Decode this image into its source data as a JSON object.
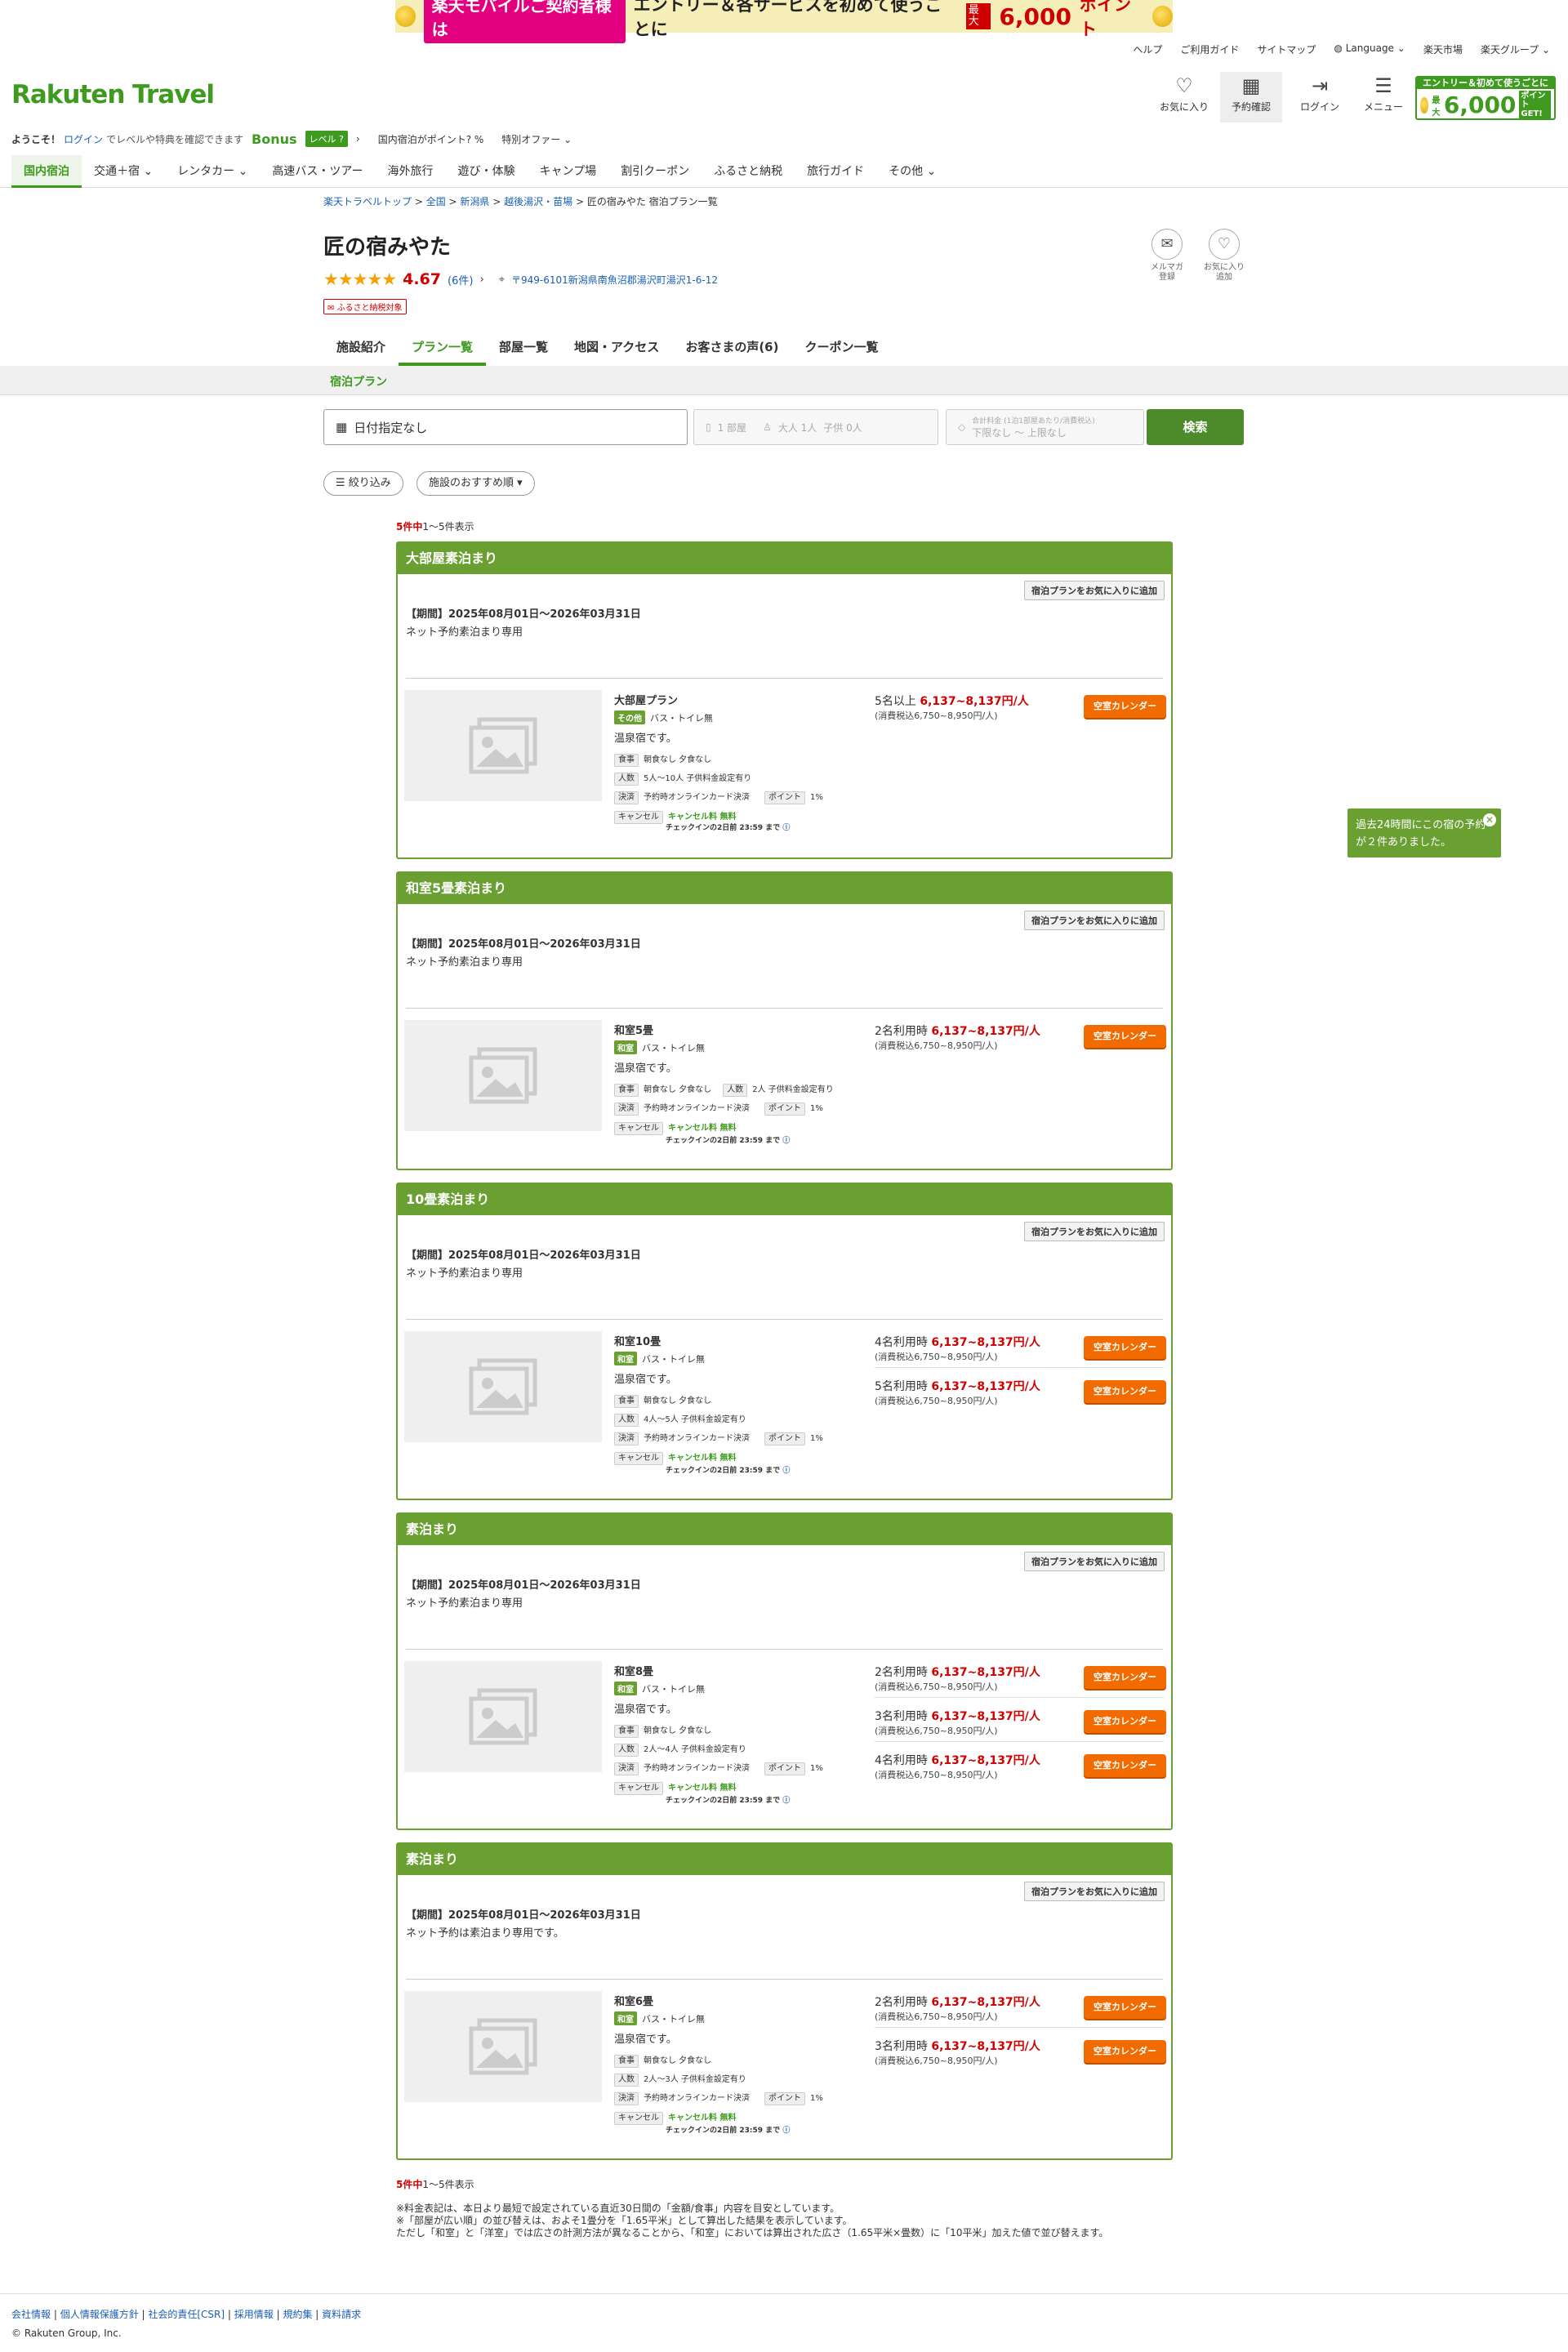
{
  "banner": {
    "pink": "楽天モバイルご契約者様は",
    "main": "エントリー＆各サービスを初めて使うごとに",
    "max": "最大",
    "points": "6,000",
    "pt_suffix": "ポイント"
  },
  "toplinks": [
    "ヘルプ",
    "ご利用ガイド",
    "サイトマップ",
    "Language",
    "楽天市場",
    "楽天グループ"
  ],
  "logo": "Rakuten Travel",
  "header_buttons": [
    {
      "label": "お気に入り",
      "icon": "♡"
    },
    {
      "label": "予約確認",
      "icon": "▦"
    },
    {
      "label": "ログイン",
      "icon": "⇥"
    },
    {
      "label": "メニュー",
      "icon": "☰"
    }
  ],
  "promo": {
    "top": "エントリー＆初めて使うごとに",
    "max": "最大",
    "points": "6,000",
    "suffix": "ポイントGET!"
  },
  "welcome": {
    "hello": "ようこそ！",
    "login": "ログイン",
    "tail": "でレベルや特典を確認できます",
    "bonus": "Bonus",
    "level": "レベル ?",
    "domestic": "国内宿泊がポイント? %",
    "special": "特別オファー"
  },
  "nav": [
    "国内宿泊",
    "交通＋宿",
    "レンタカー",
    "高速バス・ツアー",
    "海外旅行",
    "遊び・体験",
    "キャンプ場",
    "割引クーポン",
    "ふるさと納税",
    "旅行ガイド",
    "その他"
  ],
  "breadcrumb": [
    "楽天トラベルトップ",
    "全国",
    "新潟県",
    "越後湯沢・苗場",
    "匠の宿みやた 宿泊プラン一覧"
  ],
  "hotel": {
    "name": "匠の宿みやた",
    "stars": "★★★★★",
    "score": "4.67",
    "reviews": "(6件)",
    "address": "〒949-6101新潟県南魚沼郡湯沢町湯沢1-6-12",
    "furusato": "ふるさと納税対象"
  },
  "side_buttons": [
    {
      "label1": "メルマガ",
      "label2": "登録",
      "icon": "✉"
    },
    {
      "label1": "お気に入り",
      "label2": "追加",
      "icon": "♡"
    }
  ],
  "tabs": [
    "施設紹介",
    "プラン一覧",
    "部屋一覧",
    "地図・アクセス",
    "お客さまの声(6)",
    "クーポン一覧"
  ],
  "subtab": "宿泊プラン",
  "search": {
    "date": "日付指定なし",
    "rooms": "1 部屋",
    "adults": "大人 1人",
    "children": "子供 0人",
    "price_label": "合計料金 (1泊1部屋あたり/消費税込)",
    "price_min": "下限なし",
    "price_max": "上限なし",
    "button": "検索"
  },
  "filters": {
    "narrow": "絞り込み",
    "sort": "施設のおすすめ順"
  },
  "count_text": {
    "total": "5件中",
    "range": "1〜5件表示"
  },
  "plans": [
    {
      "title": "大部屋素泊まり",
      "fav": "宿泊プランをお気に入りに追加",
      "period": "【期間】2025年08月01日〜2026年03月31日",
      "note": "ネット予約素泊まり専用",
      "room": "大部屋プラン",
      "badge": "その他",
      "bath": "バス・トイレ無",
      "desc": "温泉宿です。",
      "meal": "朝食なし 夕食なし",
      "people": "5人〜10人  子供料金設定有り",
      "pay": "予約時オンラインカード決済",
      "point": "1%",
      "cancel": "キャンセル料 無料",
      "deadline": "チェックインの2日前 23:59 まで",
      "prices": [
        {
          "people": "5名以上",
          "price": "6,137~8,137円/人",
          "tax": "(消費税込6,750~8,950円/人)"
        }
      ]
    },
    {
      "title": "和室5畳素泊まり",
      "fav": "宿泊プランをお気に入りに追加",
      "period": "【期間】2025年08月01日〜2026年03月31日",
      "note": "ネット予約素泊まり専用",
      "room": "和室5畳",
      "badge": "和室",
      "bath": "バス・トイレ無",
      "desc": "温泉宿です。",
      "meal": "朝食なし 夕食なし",
      "people": "2人  子供料金設定有り",
      "pay": "予約時オンラインカード決済",
      "point": "1%",
      "cancel": "キャンセル料 無料",
      "deadline": "チェックインの2日前 23:59 まで",
      "prices": [
        {
          "people": "2名利用時",
          "price": "6,137~8,137円/人",
          "tax": "(消費税込6,750~8,950円/人)"
        }
      ]
    },
    {
      "title": "10畳素泊まり",
      "fav": "宿泊プランをお気に入りに追加",
      "period": "【期間】2025年08月01日〜2026年03月31日",
      "note": "ネット予約素泊まり専用",
      "room": "和室10畳",
      "badge": "和室",
      "bath": "バス・トイレ無",
      "desc": "温泉宿です。",
      "meal": "朝食なし 夕食なし",
      "people": "4人〜5人  子供料金設定有り",
      "pay": "予約時オンラインカード決済",
      "point": "1%",
      "cancel": "キャンセル料 無料",
      "deadline": "チェックインの2日前 23:59 まで",
      "prices": [
        {
          "people": "4名利用時",
          "price": "6,137~8,137円/人",
          "tax": "(消費税込6,750~8,950円/人)"
        },
        {
          "people": "5名利用時",
          "price": "6,137~8,137円/人",
          "tax": "(消費税込6,750~8,950円/人)"
        }
      ]
    },
    {
      "title": "素泊まり",
      "fav": "宿泊プランをお気に入りに追加",
      "period": "【期間】2025年08月01日〜2026年03月31日",
      "note": "ネット予約素泊まり専用",
      "room": "和室8畳",
      "badge": "和室",
      "bath": "バス・トイレ無",
      "desc": "温泉宿です。",
      "meal": "朝食なし 夕食なし",
      "people": "2人〜4人  子供料金設定有り",
      "pay": "予約時オンラインカード決済",
      "point": "1%",
      "cancel": "キャンセル料 無料",
      "deadline": "チェックインの2日前 23:59 まで",
      "prices": [
        {
          "people": "2名利用時",
          "price": "6,137~8,137円/人",
          "tax": "(消費税込6,750~8,950円/人)"
        },
        {
          "people": "3名利用時",
          "price": "6,137~8,137円/人",
          "tax": "(消費税込6,750~8,950円/人)"
        },
        {
          "people": "4名利用時",
          "price": "6,137~8,137円/人",
          "tax": "(消費税込6,750~8,950円/人)"
        }
      ]
    },
    {
      "title": "素泊まり",
      "fav": "宿泊プランをお気に入りに追加",
      "period": "【期間】2025年08月01日〜2026年03月31日",
      "note": "ネット予約は素泊まり専用です。",
      "room": "和室6畳",
      "badge": "和室",
      "bath": "バス・トイレ無",
      "desc": "温泉宿です。",
      "meal": "朝食なし 夕食なし",
      "people": "2人〜3人  子供料金設定有り",
      "pay": "予約時オンラインカード決済",
      "point": "1%",
      "cancel": "キャンセル料 無料",
      "deadline": "チェックインの2日前 23:59 まで",
      "prices": [
        {
          "people": "2名利用時",
          "price": "6,137~8,137円/人",
          "tax": "(消費税込6,750~8,950円/人)"
        },
        {
          "people": "3名利用時",
          "price": "6,137~8,137円/人",
          "tax": "(消費税込6,750~8,950円/人)"
        }
      ]
    }
  ],
  "labels": {
    "meal": "食事",
    "people": "人数",
    "pay": "決済",
    "point": "ポイント",
    "cancel": "キャンセル",
    "calendar": "空室カレンダー"
  },
  "popup": "過去24時間にこの宿の予約が２件ありました。",
  "notes": [
    "※料金表記は、本日より最短で設定されている直近30日間の「金額/食事」内容を目安としています。",
    "※「部屋が広い順」の並び替えは、およそ1畳分を「1.65平米」として算出した結果を表示しています。",
    "ただし「和室」と「洋室」では広さの計測方法が異なることから、「和室」においては算出された広さ（1.65平米×畳数）に「10平米」加えた値で並び替えます。"
  ],
  "footer": {
    "links": [
      "会社情報",
      "個人情報保護方針",
      "社会的責任[CSR]",
      "採用情報",
      "規約集",
      "資料請求"
    ],
    "copyright": "© Rakuten Group, Inc."
  },
  "colors": {
    "green": "#6aa032",
    "red": "#d10000",
    "orange": "#f26b00"
  }
}
